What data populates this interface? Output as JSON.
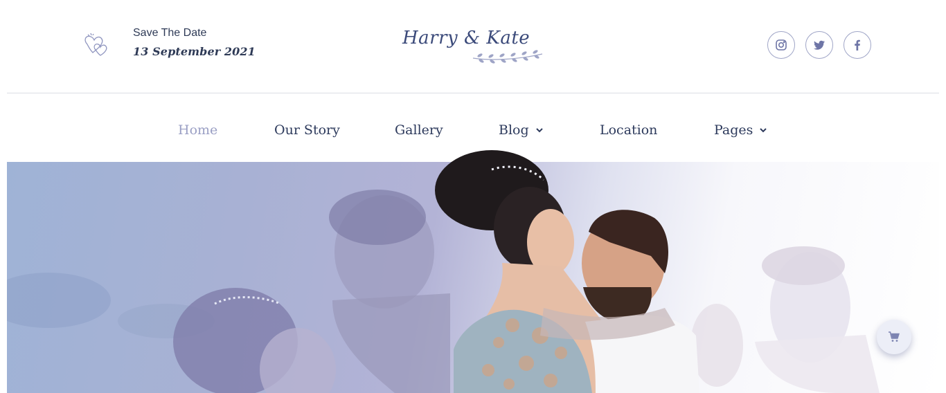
{
  "header": {
    "date_label": "Save The Date",
    "date_value": "13 September 2021",
    "logo_text": "Harry & Kate",
    "social": [
      {
        "icon": "instagram-icon"
      },
      {
        "icon": "twitter-icon"
      },
      {
        "icon": "facebook-icon"
      }
    ]
  },
  "nav": {
    "items": [
      {
        "label": "Home",
        "active": true
      },
      {
        "label": "Our Story"
      },
      {
        "label": "Gallery"
      },
      {
        "label": "Blog",
        "dropdown": true
      },
      {
        "label": "Location"
      },
      {
        "label": "Pages",
        "dropdown": true
      }
    ]
  },
  "floating": {
    "cart_icon": "cart-icon"
  },
  "colors": {
    "accent": "#9a9fc4",
    "text": "#2d3a5c",
    "icon_stroke": "#7d84b2"
  }
}
